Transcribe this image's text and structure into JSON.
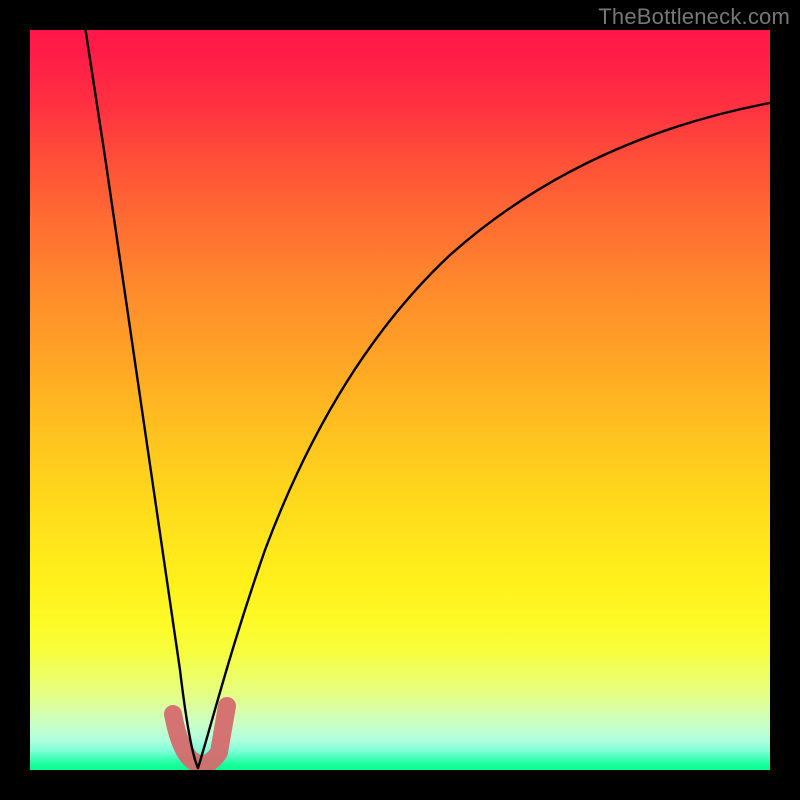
{
  "watermark": "TheBottleneck.com",
  "chart_data": {
    "type": "line",
    "title": "",
    "xlabel": "",
    "ylabel": "",
    "xlim": [
      0,
      100
    ],
    "ylim": [
      0,
      100
    ],
    "grid": false,
    "legend": false,
    "description": "Bottleneck curve: red-to-green vertical gradient background with a V-shaped black curve reaching minimum near x≈22; a short salmon-colored U marker highlights the trough.",
    "series": [
      {
        "name": "bottleneck-curve-left",
        "x": [
          7,
          10,
          13,
          16,
          18,
          20,
          21,
          22
        ],
        "y": [
          100,
          72,
          48,
          28,
          15,
          6,
          2,
          0
        ]
      },
      {
        "name": "bottleneck-curve-right",
        "x": [
          22,
          24,
          27,
          31,
          36,
          43,
          52,
          63,
          76,
          90,
          100
        ],
        "y": [
          0,
          5,
          15,
          28,
          42,
          55,
          66,
          75,
          82,
          87,
          90
        ]
      },
      {
        "name": "trough-marker",
        "x": [
          19,
          20,
          21.5,
          23,
          24,
          25,
          26
        ],
        "y": [
          7,
          2,
          0,
          0,
          2,
          5,
          9
        ]
      }
    ],
    "colors": {
      "curve": "#000000",
      "marker": "#d46b6d",
      "gradient_top": "#ff1749",
      "gradient_bottom": "#09ff8f"
    }
  }
}
